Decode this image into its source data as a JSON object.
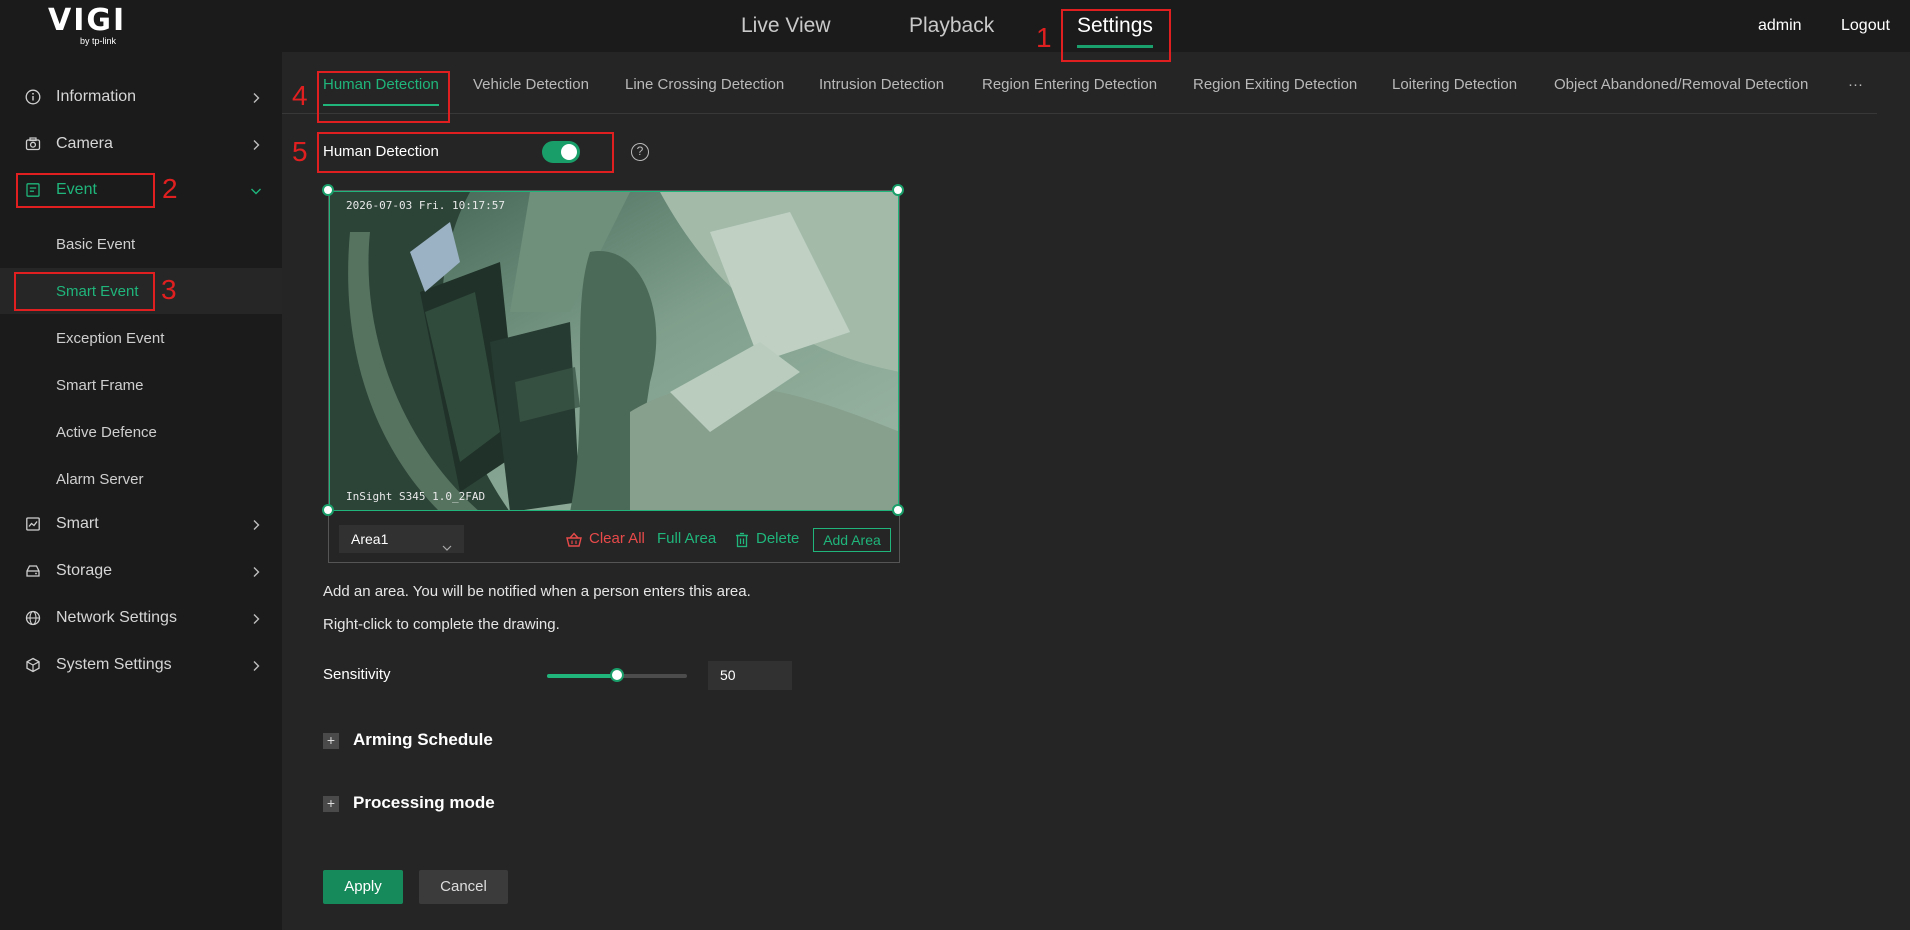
{
  "header": {
    "logo_main": "VIGI",
    "logo_sub": "by tp-link",
    "nav": [
      "Live View",
      "Playback",
      "Settings"
    ],
    "active_nav": "Settings",
    "user": "admin",
    "logout": "Logout"
  },
  "sidebar": {
    "items": [
      {
        "label": "Information",
        "icon": "info-icon"
      },
      {
        "label": "Camera",
        "icon": "camera-icon"
      },
      {
        "label": "Event",
        "icon": "event-icon"
      },
      {
        "label": "Smart",
        "icon": "smart-icon"
      },
      {
        "label": "Storage",
        "icon": "storage-icon"
      },
      {
        "label": "Network Settings",
        "icon": "globe-icon"
      },
      {
        "label": "System Settings",
        "icon": "cube-icon"
      }
    ],
    "event_sub": [
      "Basic Event",
      "Smart Event",
      "Exception Event",
      "Smart Frame",
      "Active Defence",
      "Alarm Server"
    ],
    "active_item": "Event",
    "active_sub": "Smart Event"
  },
  "tabs": [
    "Human Detection",
    "Vehicle Detection",
    "Line Crossing Detection",
    "Intrusion Detection",
    "Region Entering Detection",
    "Region Exiting Detection",
    "Loitering Detection",
    "Object Abandoned/Removal Detection",
    "···"
  ],
  "detection": {
    "label": "Human Detection",
    "enabled": true,
    "help": "?"
  },
  "video": {
    "timestamp": "2026-07-03 Fri. 10:17:57",
    "device": "InSight S345 1.0_2FAD"
  },
  "area_bar": {
    "selected": "Area1",
    "clear_all": "Clear All",
    "full_area": "Full Area",
    "delete": "Delete",
    "add_area": "Add Area"
  },
  "notes": {
    "line1": "Add an area. You will be notified when a person enters this area.",
    "line2": "Right-click to complete the drawing."
  },
  "sensitivity": {
    "label": "Sensitivity",
    "value": "50",
    "fraction": 0.5
  },
  "sections": {
    "arming": "Arming Schedule",
    "processing": "Processing mode",
    "expand_symbol": "+"
  },
  "buttons": {
    "apply": "Apply",
    "cancel": "Cancel"
  },
  "annotations": [
    "1",
    "2",
    "3",
    "4",
    "5"
  ],
  "colors": {
    "accent": "#1fb57b",
    "danger": "#e84a4a",
    "annotation": "#e02020"
  }
}
